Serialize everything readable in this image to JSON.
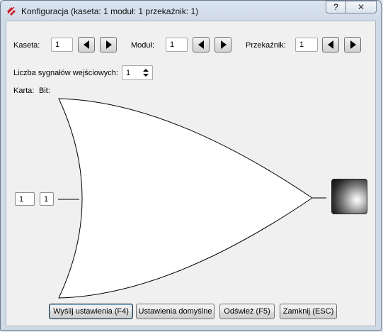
{
  "window": {
    "title": "Konfiguracja (kaseta: 1 moduł: 1 przekaźnik: 1)",
    "help_label": "?",
    "close_label": "✕"
  },
  "selectors": {
    "kaseta": {
      "label": "Kaseta:",
      "value": "1"
    },
    "modul": {
      "label": "Moduł:",
      "value": "1"
    },
    "przekaznik": {
      "label": "Przekaźnik:",
      "value": "1"
    }
  },
  "inputs_count": {
    "label": "Liczba sygnałów wejściowych:",
    "value": "1"
  },
  "karta_label": "Karta:",
  "bit_label": "Bit:",
  "gate_input": {
    "karta": "1",
    "bit": "1"
  },
  "output_led": {
    "state": "off",
    "color": "#2e2e2e"
  },
  "buttons": {
    "send": "Wyślij ustawienia  (F4)",
    "defaults": "Ustawienia domyślne",
    "refresh": "Odśwież  (F5)",
    "close": "Zamknij  (ESC)"
  },
  "icons": {
    "app": "app-logo-icon",
    "help": "help-icon",
    "close": "close-icon",
    "prev": "triangle-left-icon",
    "next": "triangle-right-icon",
    "spin": "spin-up-down-icon"
  }
}
